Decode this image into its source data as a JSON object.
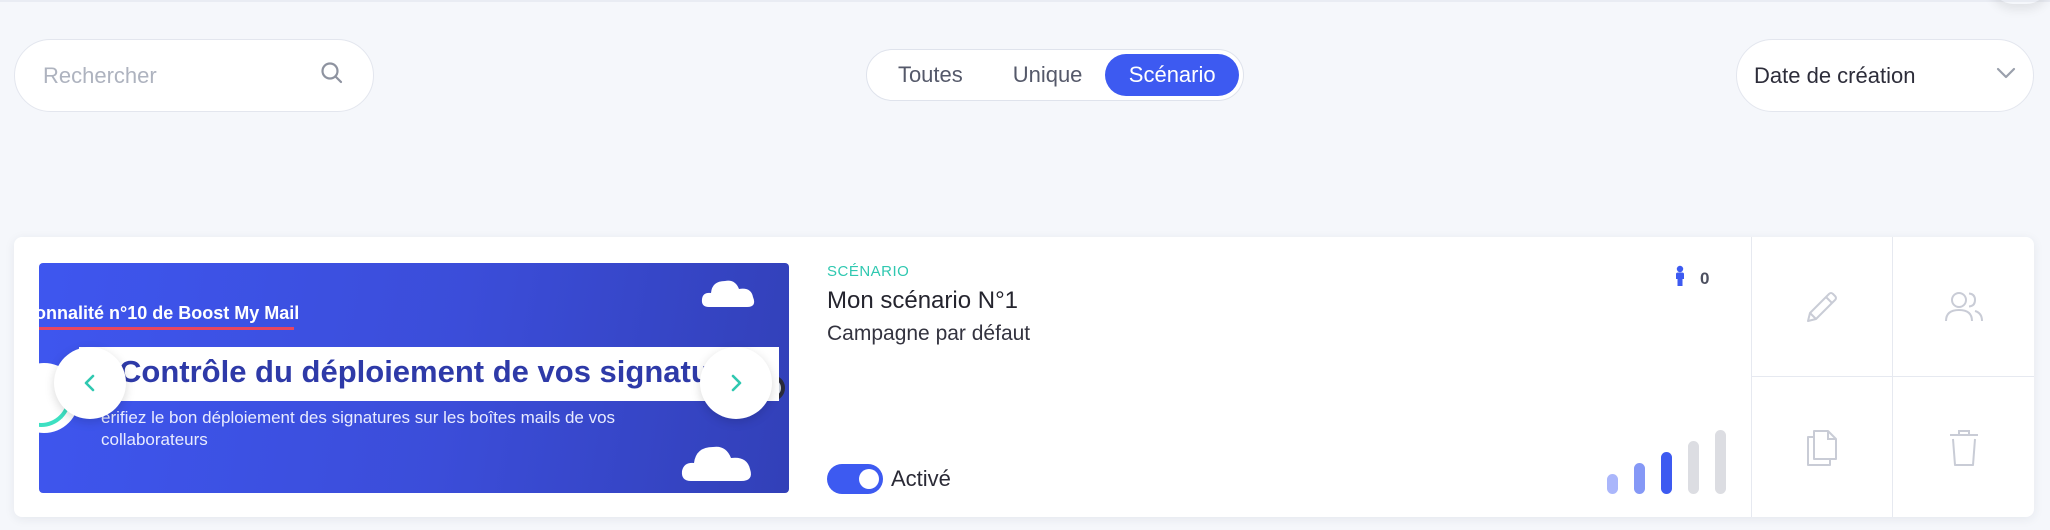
{
  "search": {
    "placeholder": "Rechercher",
    "icon": "search-icon"
  },
  "filter": {
    "options": [
      "Toutes",
      "Unique",
      "Scénario"
    ],
    "selected": "Scénario"
  },
  "sort": {
    "value": "Date de création",
    "icon": "chevron-down-icon"
  },
  "colors": {
    "accent": "#3d5af1",
    "teal": "#2fc8b0",
    "banner_red": "#e8465f"
  },
  "card": {
    "banner": {
      "kicker": "onnalité n°10 de Boost My Mail",
      "headline": "Contrôle du déploiement de vos signatures",
      "description": "érifiez le bon déploiement des signatures sur les boîtes mails de vos collaborateurs"
    },
    "type_label": "SCÉNARIO",
    "name": "Mon scénario N°1",
    "campaign": "Campagne par défaut",
    "recipients_count": "0",
    "status": {
      "active": true,
      "label": "Activé"
    },
    "signal_level": 3,
    "signal_max": 5,
    "actions": [
      {
        "name": "edit",
        "icon": "pencil-icon"
      },
      {
        "name": "users",
        "icon": "users-icon"
      },
      {
        "name": "duplicate",
        "icon": "copy-icon"
      },
      {
        "name": "delete",
        "icon": "trash-icon"
      }
    ]
  }
}
